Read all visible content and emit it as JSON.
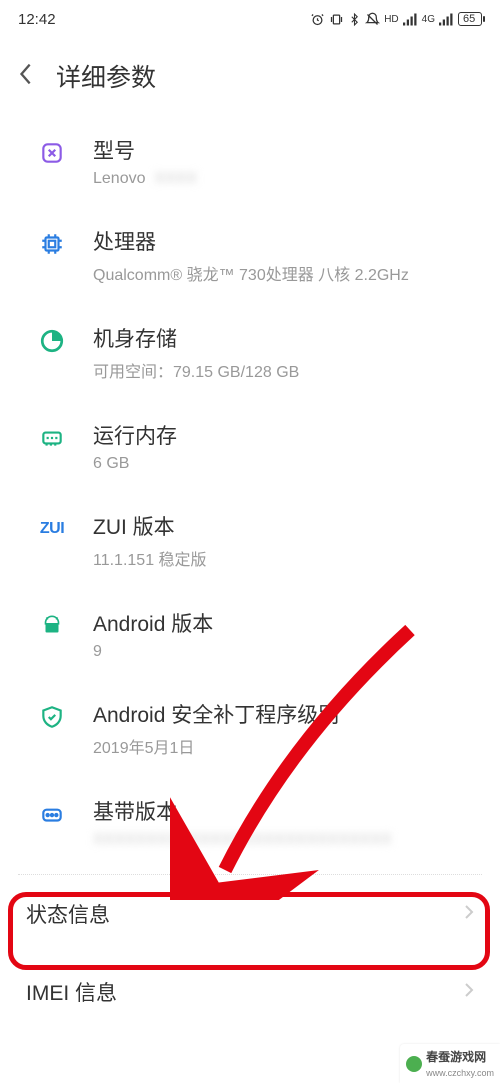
{
  "status": {
    "time": "12:42",
    "hd": "HD",
    "net": "4G",
    "battery": "65"
  },
  "header": {
    "title": "详细参数"
  },
  "items": {
    "model": {
      "title": "型号",
      "sub": "Lenovo"
    },
    "cpu": {
      "title": "处理器",
      "sub": "Qualcomm® 骁龙™ 730处理器 八核 2.2GHz"
    },
    "storage": {
      "title": "机身存储",
      "sub": "可用空间：79.15 GB/128 GB"
    },
    "ram": {
      "title": "运行内存",
      "sub": "6 GB"
    },
    "zui": {
      "title": "ZUI 版本",
      "sub": "11.1.151 稳定版",
      "iconText": "ZUI"
    },
    "android": {
      "title": "Android 版本",
      "sub": "9"
    },
    "patch": {
      "title": "Android 安全补丁程序级别",
      "sub": "2019年5月1日"
    },
    "baseband": {
      "title": "基带版本",
      "sub": ""
    }
  },
  "nav": {
    "status": {
      "title": "状态信息"
    },
    "imei": {
      "title": "IMEI 信息"
    }
  },
  "watermark": {
    "site": "春蚕游戏网",
    "url": "www.czchxy.com"
  }
}
